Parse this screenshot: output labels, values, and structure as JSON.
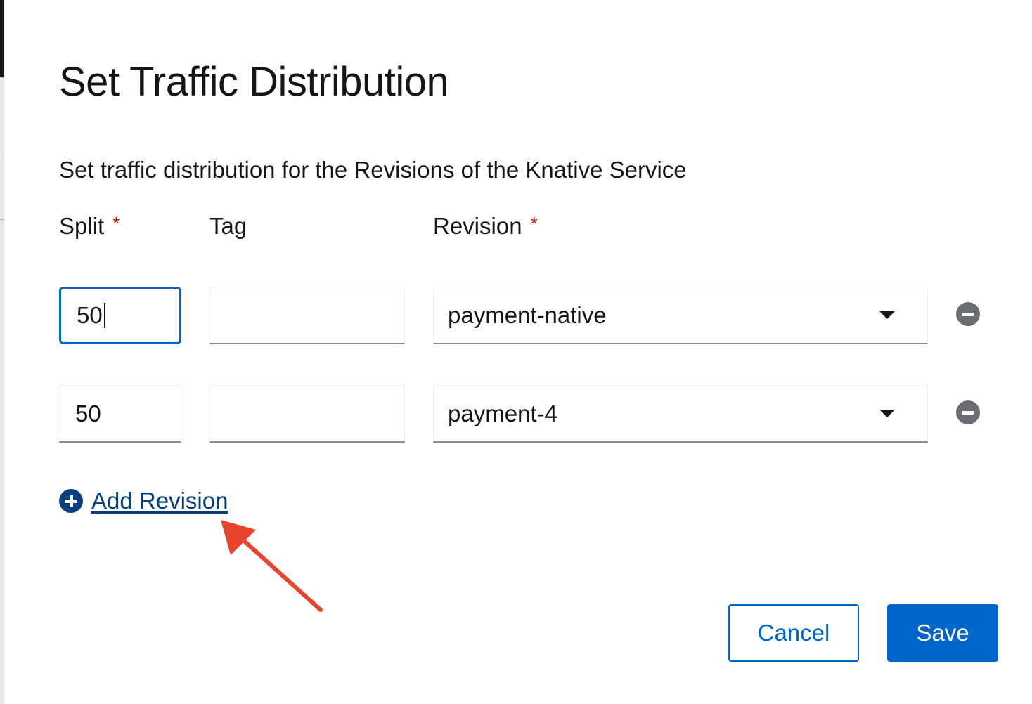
{
  "modal": {
    "title": "Set Traffic Distribution",
    "description": "Set traffic distribution for the Revisions of the Knative Service"
  },
  "columns": {
    "split": "Split",
    "tag": "Tag",
    "revision": "Revision",
    "required_marker": "*"
  },
  "rows": [
    {
      "split": "50",
      "tag": "",
      "revision": "payment-native"
    },
    {
      "split": "50",
      "tag": "",
      "revision": "payment-4"
    }
  ],
  "add_revision_label": "Add Revision",
  "buttons": {
    "cancel": "Cancel",
    "save": "Save"
  },
  "colors": {
    "primary": "#0066cc",
    "link": "#06407f",
    "required": "#c9190b",
    "annotation_arrow": "#e8432b"
  }
}
